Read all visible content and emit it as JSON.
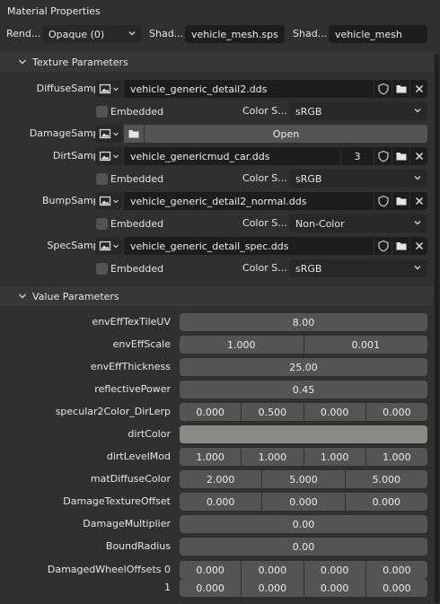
{
  "panel": {
    "title": "Material Properties"
  },
  "topbar": {
    "render_label": "Rend...",
    "render_value": "Opaque (0)",
    "shader1_label": "Shad...",
    "shader1_value": "vehicle_mesh.sps",
    "shader2_label": "Shad...",
    "shader2_value": "vehicle_mesh"
  },
  "texture_section": {
    "title": "Texture Parameters",
    "embedded_label": "Embedded",
    "colorspace_label": "Color S...",
    "open_label": "Open",
    "samplers": [
      {
        "label": "DiffuseSampler",
        "value": "vehicle_generic_detail2.dds",
        "color_space": "sRGB"
      },
      {
        "label": "DamageSampler"
      },
      {
        "label": "DirtSampler",
        "value": "vehicle_genericmud_car.dds",
        "users": "3",
        "color_space": "sRGB"
      },
      {
        "label": "BumpSampler",
        "value": "vehicle_generic_detail2_normal.dds",
        "color_space": "Non-Color"
      },
      {
        "label": "SpecSampler",
        "value": "vehicle_generic_detail_spec.dds",
        "color_space": "sRGB"
      }
    ]
  },
  "value_section": {
    "title": "Value Parameters",
    "params": [
      {
        "label": "envEffTexTileUV",
        "values": [
          "8.00"
        ]
      },
      {
        "label": "envEffScale",
        "values": [
          "1.000",
          "0.001"
        ]
      },
      {
        "label": "envEffThickness",
        "values": [
          "25.00"
        ]
      },
      {
        "label": "reflectivePower",
        "values": [
          "0.45"
        ]
      },
      {
        "label": "specular2Color_DirLerp",
        "values": [
          "0.000",
          "0.500",
          "0.000",
          "0.000"
        ]
      },
      {
        "label": "dirtColor",
        "color": "#8a8a86"
      },
      {
        "label": "dirtLevelMod",
        "values": [
          "1.000",
          "1.000",
          "1.000",
          "1.000"
        ]
      },
      {
        "label": "matDiffuseColor",
        "values": [
          "2.000",
          "5.000",
          "5.000"
        ]
      },
      {
        "label": "DamageTextureOffset",
        "values": [
          "0.000",
          "0.000",
          "0.000"
        ]
      },
      {
        "label": "DamageMultiplier",
        "values": [
          "0.00"
        ]
      },
      {
        "label": "BoundRadius",
        "values": [
          "0.00"
        ]
      },
      {
        "label": "DamagedWheelOffsets 0",
        "values": [
          "0.000",
          "0.000",
          "0.000",
          "0.000"
        ]
      },
      {
        "label": "1",
        "values": [
          "0.000",
          "0.000",
          "0.000",
          "0.000"
        ]
      }
    ]
  },
  "icons": [
    "image-icon",
    "chevron-down-icon",
    "shield-icon",
    "folder-icon",
    "close-icon",
    "collapse-arrow-icon"
  ],
  "colors": {
    "background": "#303030",
    "field": "#545454",
    "textfield": "#1d1d1d",
    "header": "#373737"
  }
}
